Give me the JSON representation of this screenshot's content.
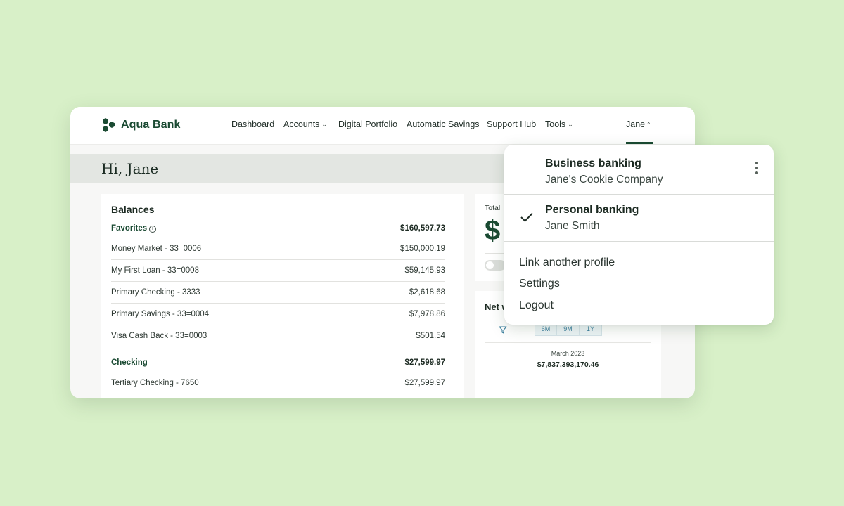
{
  "app": {
    "name": "Aqua Bank",
    "brand_color": "#1a4a32"
  },
  "nav": {
    "items": [
      {
        "label": "Dashboard"
      },
      {
        "label": "Accounts"
      },
      {
        "label": "Digital Portfolio"
      },
      {
        "label": "Automatic Savings"
      },
      {
        "label": "Support Hub"
      },
      {
        "label": "Tools"
      }
    ],
    "user_label": "Jane"
  },
  "greeting": "Hi, Jane",
  "balances": {
    "title": "Balances",
    "favorites_label": "Favorites",
    "favorites_total": "$160,597.73",
    "favorites": [
      {
        "name": "Money Market - 33=0006",
        "amount": "$150,000.19"
      },
      {
        "name": "My First Loan - 33=0008",
        "amount": "$59,145.93"
      },
      {
        "name": "Primary Checking - 3333",
        "amount": "$2,618.68"
      },
      {
        "name": "Primary Savings - 33=0004",
        "amount": "$7,978.86"
      },
      {
        "name": "Visa Cash Back - 33=0003",
        "amount": "$501.54"
      }
    ],
    "checking_label": "Checking",
    "checking_total": "$27,599.97",
    "checking": [
      {
        "name": "Tertiary Checking - 7650",
        "amount": "$27,599.97"
      }
    ]
  },
  "total_card": {
    "label": "Total",
    "symbol": "$"
  },
  "net_card": {
    "title": "Net w",
    "ranges": [
      "6M",
      "9M",
      "1Y"
    ],
    "date": "March 2023",
    "value": "$7,837,393,170.46"
  },
  "dropdown": {
    "profiles": [
      {
        "title": "Business banking",
        "subtitle": "Jane's Cookie Company"
      },
      {
        "title": "Personal banking",
        "subtitle": "Jane Smith"
      }
    ],
    "links": [
      {
        "label": "Link another profile"
      },
      {
        "label": "Settings"
      },
      {
        "label": "Logout"
      }
    ]
  }
}
